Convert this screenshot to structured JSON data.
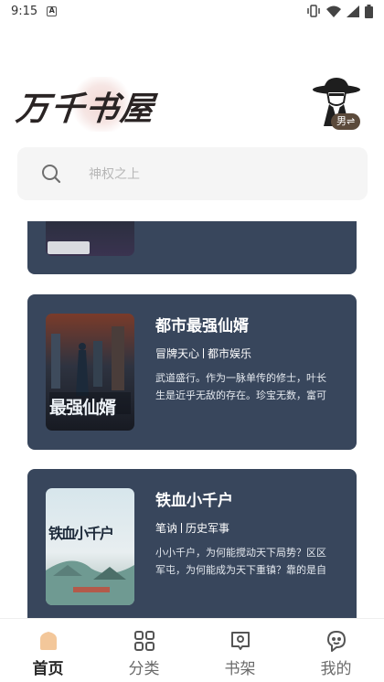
{
  "status_bar": {
    "time": "9:15",
    "notification_letter": "A"
  },
  "app": {
    "logo_text": "万千书屋",
    "gender_toggle": "男⇌"
  },
  "search": {
    "placeholder": "神权之上"
  },
  "books": [
    {
      "title": "都市最强仙婿",
      "author": "冒牌天心",
      "category": "都市娱乐",
      "description": "武道盛行。作为一脉单传的修士，叶长生是近乎无敌的存在。珍宝无数，富可",
      "cover_text": "最强仙婿"
    },
    {
      "title": "铁血小千户",
      "author": "笔讷",
      "category": "历史军事",
      "description": "小小千户，为何能搅动天下局势？区区军屯，为何能成为天下重镇？靠的是自",
      "cover_text": "铁血小千户"
    }
  ],
  "tabs": [
    {
      "label": "首页",
      "icon": "home-icon",
      "active": true
    },
    {
      "label": "分类",
      "icon": "grid-icon",
      "active": false
    },
    {
      "label": "书架",
      "icon": "bookshelf-icon",
      "active": false
    },
    {
      "label": "我的",
      "icon": "profile-icon",
      "active": false
    }
  ],
  "colors": {
    "card_bg": "#38465c",
    "tab_active": "#f3c79a",
    "gender_badge": "#5b4a3b"
  }
}
